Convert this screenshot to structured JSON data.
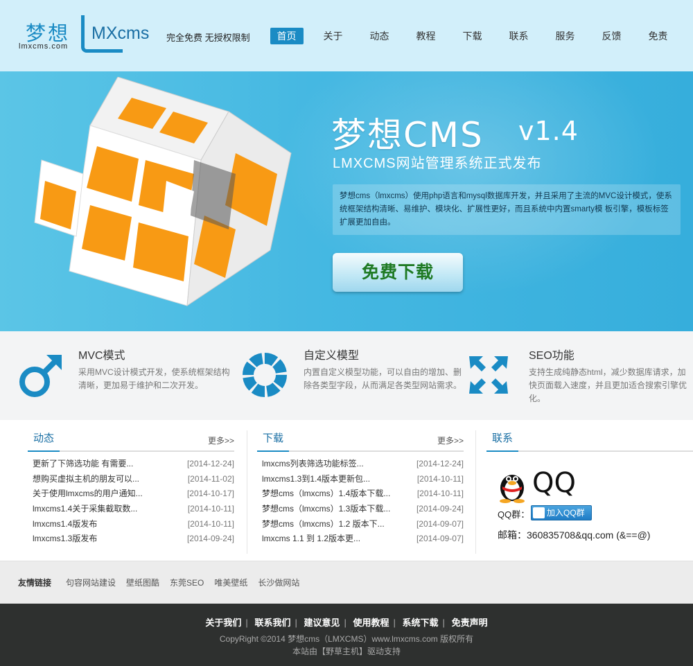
{
  "header": {
    "logo_cn": "梦想",
    "logo_url": "lmxcms.com",
    "logo_mx": "MXcms",
    "tagline": "完全免费 无授权限制",
    "nav": [
      {
        "label": "首页",
        "active": true
      },
      {
        "label": "关于",
        "active": false
      },
      {
        "label": "动态",
        "active": false
      },
      {
        "label": "教程",
        "active": false
      },
      {
        "label": "下载",
        "active": false
      },
      {
        "label": "联系",
        "active": false
      },
      {
        "label": "服务",
        "active": false
      },
      {
        "label": "反馈",
        "active": false
      },
      {
        "label": "免责",
        "active": false
      }
    ]
  },
  "banner": {
    "title": "梦想CMS",
    "version": "v1.4",
    "subtitle": "LMXCMS网站管理系统正式发布",
    "description": "梦想cms（lmxcms）使用php语言和mysql数据库开发，并且采用了主流的MVC设计模式，使系统框架结构清晰、易维护、模块化、扩展性更好，而且系统中内置smarty模 板引擎，模板标签扩展更加自由。",
    "download_label": "免费下载",
    "colors": {
      "orange": "#f89a14",
      "blue": "#45b8e2"
    }
  },
  "features": [
    {
      "icon": "male-symbol-icon",
      "title": "MVC模式",
      "desc": "采用MVC设计模式开发，使系统框架结构清晰，更加易于维护和二次开发。"
    },
    {
      "icon": "ring-segments-icon",
      "title": "自定义模型",
      "desc": "内置自定义模型功能，可以自由的增加、删除各类型字段，从而满足各类型网站需求。"
    },
    {
      "icon": "expand-arrows-icon",
      "title": "SEO功能",
      "desc": "支持生成纯静态html，减少数据库请求，加快页面载入速度，并且更加适合搜索引擎优化。"
    }
  ],
  "news": {
    "title": "动态",
    "more": "更多>>",
    "items": [
      {
        "text": "更新了下筛选功能 有需要...",
        "date": "[2014-12-24]"
      },
      {
        "text": "想购买虚拟主机的朋友可以...",
        "date": "[2014-11-02]"
      },
      {
        "text": "关于使用lmxcms的用户通知...",
        "date": "[2014-10-17]"
      },
      {
        "text": "lmxcms1.4关于采集截取数...",
        "date": "[2014-10-11]"
      },
      {
        "text": "lmxcms1.4版发布",
        "date": "[2014-10-11]"
      },
      {
        "text": "lmxcms1.3版发布",
        "date": "[2014-09-24]"
      }
    ]
  },
  "downloads": {
    "title": "下载",
    "more": "更多>>",
    "items": [
      {
        "text": "lmxcms列表筛选功能标签...",
        "date": "[2014-12-24]"
      },
      {
        "text": "lmxcms1.3到1.4版本更新包...",
        "date": "[2014-10-11]"
      },
      {
        "text": "梦想cms（lmxcms）1.4版本下载...",
        "date": "[2014-10-11]"
      },
      {
        "text": "梦想cms（lmxcms）1.3版本下载...",
        "date": "[2014-09-24]"
      },
      {
        "text": "梦想cms（lmxcms）1.2 版本下...",
        "date": "[2014-09-07]"
      },
      {
        "text": "lmxcms 1.1 到 1.2版本更...",
        "date": "[2014-09-07]"
      }
    ]
  },
  "contact": {
    "title": "联系",
    "qq_label": "QQ",
    "qq_group_label": "QQ群：",
    "qq_group_button": "加入QQ群",
    "email": "邮箱：360835708&qq.com (&==@)"
  },
  "links": {
    "label": "友情链接",
    "items": [
      "句容网站建设",
      "壁纸图酷",
      "东莞SEO",
      "唯美壁纸",
      "长沙做网站"
    ]
  },
  "footer": {
    "nav": [
      "关于我们",
      "联系我们",
      "建议意见",
      "使用教程",
      "系统下载",
      "免责声明"
    ],
    "copyright": "CopyRight ©2014 梦想cms（LMXCMS）www.lmxcms.com 版权所有",
    "powered": "本站由【野草主机】驱动支持"
  }
}
